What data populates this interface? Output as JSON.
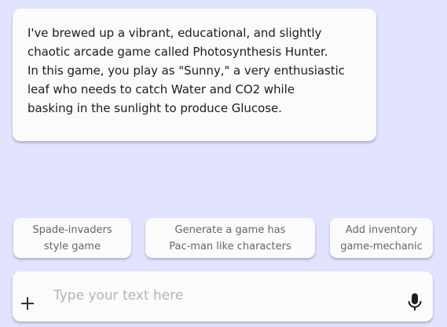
{
  "chat": {
    "message": "I've brewed up a vibrant, educational, and slightly\nchaotic arcade game called Photosynthesis Hunter.\nIn this game, you play as \"Sunny,\" a very enthusiastic\nleaf who needs to catch Water and CO2 while\nbasking in the sunlight to produce Glucose."
  },
  "suggestions": [
    {
      "label": "Spade-invaders\nstyle game"
    },
    {
      "label": "Generate a game has\nPac-man like characters"
    },
    {
      "label": "Add inventory\ngame-mechanic"
    }
  ],
  "input": {
    "placeholder": "Type your text here",
    "value": "",
    "add_icon": "plus-icon",
    "voice_icon": "microphone-icon"
  },
  "colors": {
    "background": "#e2e4ff",
    "card": "#fbfbfb",
    "text": "#1c1c1c",
    "muted_text": "#666666",
    "placeholder": "#b3b3b3"
  }
}
